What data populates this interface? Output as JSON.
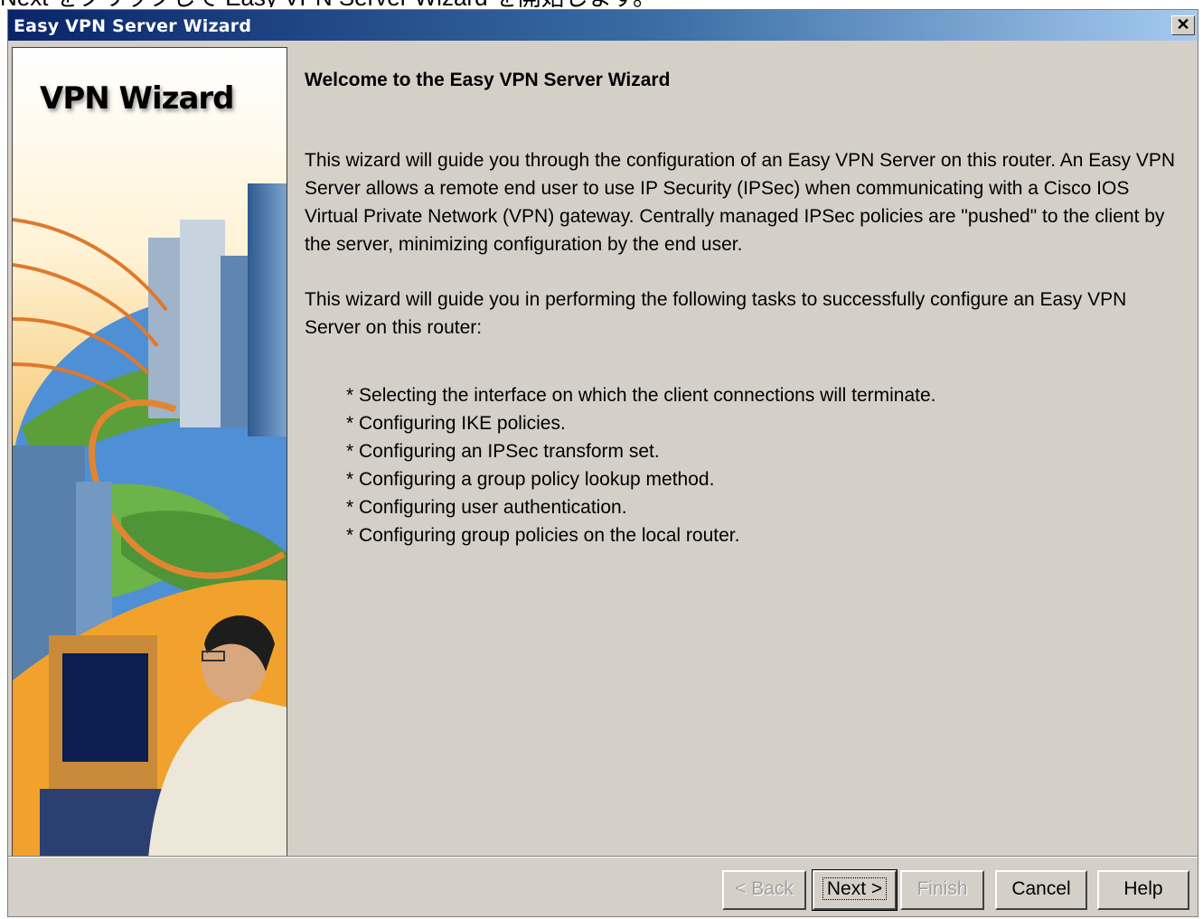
{
  "caption": "Next をクリックして Easy VPN Server Wizard を開始します。",
  "window": {
    "title": "Easy VPN Server Wizard",
    "close_glyph": "✕"
  },
  "sidebar": {
    "title": "VPN Wizard"
  },
  "content": {
    "heading": "Welcome to the Easy VPN Server Wizard",
    "para1": "This wizard will guide you through the configuration of an Easy VPN Server on this router. An Easy VPN Server allows a remote end user to use IP Security (IPSec) when communicating with a Cisco IOS Virtual Private Network (VPN) gateway. Centrally managed IPSec policies are \"pushed\" to the client by the server, minimizing configuration by the end user.",
    "para2": "This wizard will guide you in performing the following tasks to successfully configure an Easy VPN Server on this router:",
    "tasks": [
      "* Selecting the interface on which the client connections will terminate.",
      "* Configuring IKE policies.",
      "* Configuring an IPSec transform set.",
      "* Configuring a group policy lookup method.",
      "* Configuring user authentication.",
      "* Configuring group policies on the local router."
    ]
  },
  "buttons": {
    "back": "< Back",
    "next": "Next >",
    "finish": "Finish",
    "cancel": "Cancel",
    "help": "Help"
  },
  "colors": {
    "dialog_bg": "#d4d0c8",
    "titlebar_start": "#0a246a",
    "titlebar_end": "#a6caf0"
  }
}
